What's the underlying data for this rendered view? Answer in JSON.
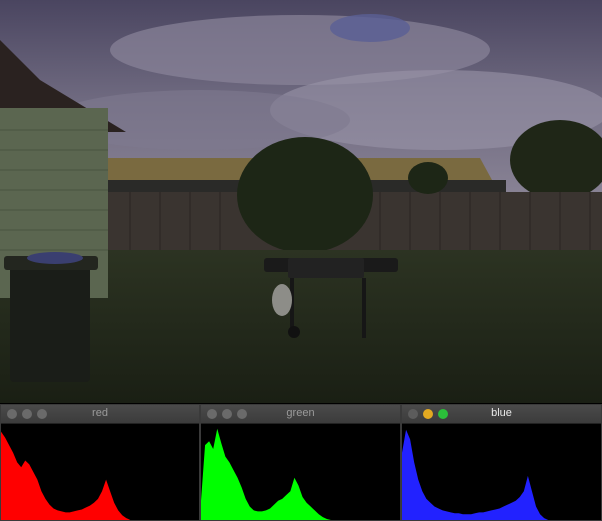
{
  "photo": {
    "description_icon": "backyard-photo"
  },
  "windows": [
    {
      "title": "red",
      "color": "#ff0000",
      "active": false
    },
    {
      "title": "green",
      "color": "#00ff00",
      "active": false
    },
    {
      "title": "blue",
      "color": "#2222ff",
      "active": true
    }
  ],
  "chart_data": [
    {
      "type": "area",
      "series": [
        {
          "name": "red",
          "values": [
            0.92,
            0.86,
            0.78,
            0.7,
            0.6,
            0.55,
            0.62,
            0.58,
            0.5,
            0.42,
            0.3,
            0.22,
            0.16,
            0.12,
            0.1,
            0.09,
            0.08,
            0.08,
            0.09,
            0.1,
            0.11,
            0.13,
            0.15,
            0.18,
            0.22,
            0.3,
            0.42,
            0.3,
            0.18,
            0.1,
            0.05,
            0.02,
            0,
            0,
            0,
            0,
            0,
            0,
            0,
            0,
            0,
            0,
            0,
            0,
            0,
            0,
            0,
            0,
            0,
            0
          ]
        }
      ],
      "ylim": [
        0,
        1
      ]
    },
    {
      "type": "area",
      "series": [
        {
          "name": "green",
          "values": [
            0.2,
            0.78,
            0.82,
            0.74,
            0.95,
            0.8,
            0.66,
            0.6,
            0.52,
            0.44,
            0.34,
            0.22,
            0.14,
            0.1,
            0.09,
            0.09,
            0.1,
            0.12,
            0.16,
            0.2,
            0.22,
            0.26,
            0.3,
            0.44,
            0.36,
            0.24,
            0.18,
            0.14,
            0.1,
            0.06,
            0.03,
            0.01,
            0,
            0,
            0,
            0,
            0,
            0,
            0,
            0,
            0,
            0,
            0,
            0,
            0,
            0,
            0,
            0,
            0,
            0
          ]
        }
      ],
      "ylim": [
        0,
        1
      ]
    },
    {
      "type": "area",
      "series": [
        {
          "name": "blue",
          "values": [
            0.7,
            0.94,
            0.84,
            0.6,
            0.42,
            0.3,
            0.22,
            0.18,
            0.14,
            0.12,
            0.1,
            0.09,
            0.08,
            0.07,
            0.07,
            0.06,
            0.06,
            0.06,
            0.07,
            0.08,
            0.08,
            0.09,
            0.1,
            0.11,
            0.12,
            0.14,
            0.16,
            0.18,
            0.2,
            0.24,
            0.3,
            0.46,
            0.3,
            0.14,
            0.06,
            0.02,
            0,
            0,
            0,
            0,
            0,
            0,
            0,
            0,
            0,
            0,
            0,
            0,
            0,
            0
          ]
        }
      ],
      "ylim": [
        0,
        1
      ]
    }
  ]
}
